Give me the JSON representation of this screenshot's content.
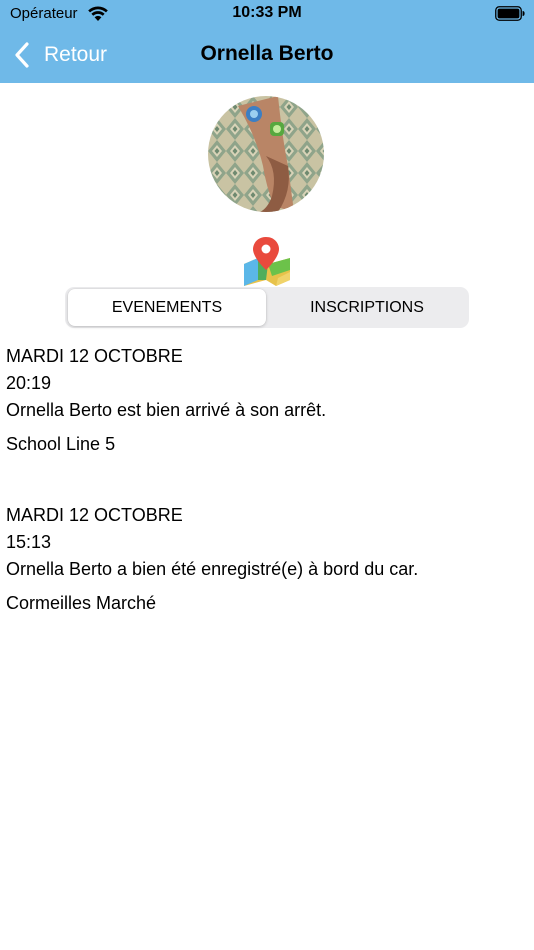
{
  "status_bar": {
    "carrier": "Opérateur",
    "time": "10:33 PM"
  },
  "nav": {
    "back_label": "Retour",
    "title": "Ornella Berto"
  },
  "colors": {
    "header": "#6fb9e8",
    "segment_bg": "#ececee"
  },
  "tabs": [
    {
      "label": "EVENEMENTS",
      "selected": true
    },
    {
      "label": "INSCRIPTIONS",
      "selected": false
    }
  ],
  "events": [
    {
      "date": "MARDI 12 OCTOBRE",
      "time": "20:19",
      "message": "Ornella Berto est bien arrivé à son arrêt.",
      "stop": "School Line 5"
    },
    {
      "date": "MARDI 12 OCTOBRE",
      "time": "15:13",
      "message": "Ornella Berto a bien été enregistré(e) à bord du car.",
      "stop": "Cormeilles Marché"
    }
  ]
}
